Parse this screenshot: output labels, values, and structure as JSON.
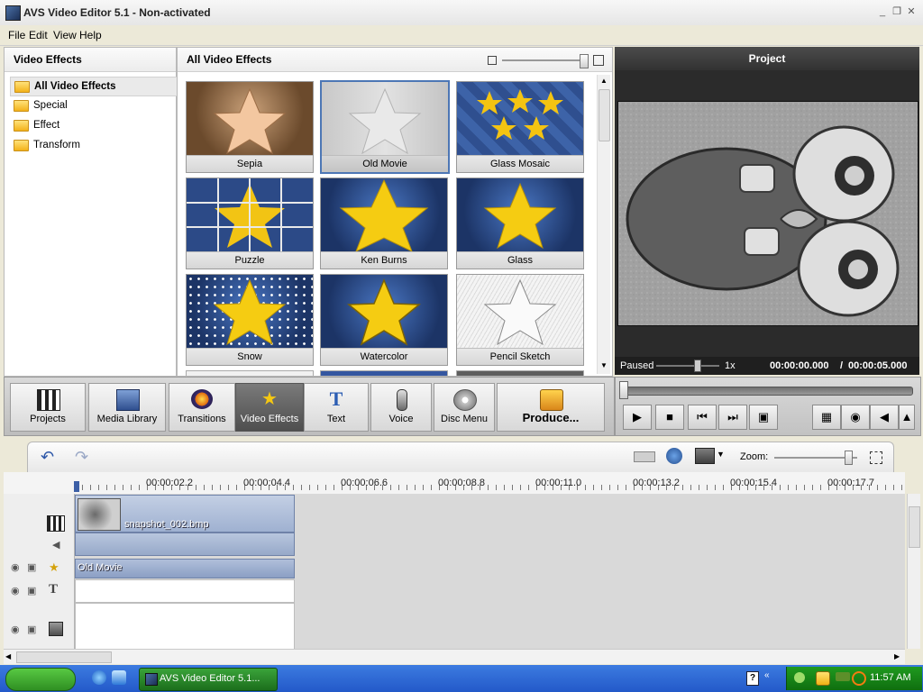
{
  "window": {
    "title": "AVS Video Editor 5.1 - Non-activated",
    "controls": [
      "_",
      "❐",
      "✕"
    ]
  },
  "menu": [
    "File",
    "Edit",
    "View",
    "Help"
  ],
  "left_panel": {
    "title": "Video Effects",
    "items": [
      {
        "label": "All Video Effects",
        "selected": true
      },
      {
        "label": "Special"
      },
      {
        "label": "Effect"
      },
      {
        "label": "Transform"
      }
    ]
  },
  "effects_panel": {
    "title": "All Video Effects",
    "effects": [
      "Sepia",
      "Old Movie",
      "Glass Mosaic",
      "Puzzle",
      "Ken Burns",
      "Glass",
      "Snow",
      "Watercolor",
      "Pencil Sketch"
    ]
  },
  "preview": {
    "title": "Project",
    "status": "Paused",
    "speed": "1x",
    "current_time": "00:00:00.000",
    "separator": "/",
    "total_time": "00:00:05.000"
  },
  "toolbar": {
    "buttons": [
      "Projects",
      "Media Library",
      "Transitions",
      "Video Effects",
      "Text",
      "Voice",
      "Disc Menu"
    ],
    "produce": "Produce..."
  },
  "timeline": {
    "zoom_label": "Zoom:",
    "ruler": [
      "00:00:02.2",
      "00:00:04.4",
      "00:00:06.6",
      "00:00:08.8",
      "00:00:11.0",
      "00:00:13.2",
      "00:00:15.4",
      "00:00:17.7"
    ],
    "clip_name": "snapshot_002.bmp",
    "effect_name": "Old Movie"
  },
  "taskbar": {
    "task": "AVS Video Editor 5.1...",
    "clock": "11:57 AM"
  },
  "colors": {
    "accent": "#4d77b5",
    "clip": "#a9b9d4",
    "taskbar": "#2f68d8",
    "start": "#3fae29"
  }
}
